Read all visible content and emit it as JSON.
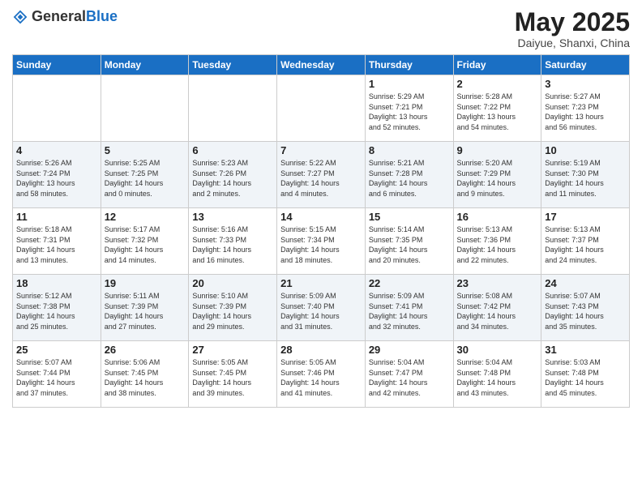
{
  "header": {
    "logo_general": "General",
    "logo_blue": "Blue",
    "month_year": "May 2025",
    "location": "Daiyue, Shanxi, China"
  },
  "weekdays": [
    "Sunday",
    "Monday",
    "Tuesday",
    "Wednesday",
    "Thursday",
    "Friday",
    "Saturday"
  ],
  "weeks": [
    [
      {
        "day": "",
        "info": ""
      },
      {
        "day": "",
        "info": ""
      },
      {
        "day": "",
        "info": ""
      },
      {
        "day": "",
        "info": ""
      },
      {
        "day": "1",
        "info": "Sunrise: 5:29 AM\nSunset: 7:21 PM\nDaylight: 13 hours\nand 52 minutes."
      },
      {
        "day": "2",
        "info": "Sunrise: 5:28 AM\nSunset: 7:22 PM\nDaylight: 13 hours\nand 54 minutes."
      },
      {
        "day": "3",
        "info": "Sunrise: 5:27 AM\nSunset: 7:23 PM\nDaylight: 13 hours\nand 56 minutes."
      }
    ],
    [
      {
        "day": "4",
        "info": "Sunrise: 5:26 AM\nSunset: 7:24 PM\nDaylight: 13 hours\nand 58 minutes."
      },
      {
        "day": "5",
        "info": "Sunrise: 5:25 AM\nSunset: 7:25 PM\nDaylight: 14 hours\nand 0 minutes."
      },
      {
        "day": "6",
        "info": "Sunrise: 5:23 AM\nSunset: 7:26 PM\nDaylight: 14 hours\nand 2 minutes."
      },
      {
        "day": "7",
        "info": "Sunrise: 5:22 AM\nSunset: 7:27 PM\nDaylight: 14 hours\nand 4 minutes."
      },
      {
        "day": "8",
        "info": "Sunrise: 5:21 AM\nSunset: 7:28 PM\nDaylight: 14 hours\nand 6 minutes."
      },
      {
        "day": "9",
        "info": "Sunrise: 5:20 AM\nSunset: 7:29 PM\nDaylight: 14 hours\nand 9 minutes."
      },
      {
        "day": "10",
        "info": "Sunrise: 5:19 AM\nSunset: 7:30 PM\nDaylight: 14 hours\nand 11 minutes."
      }
    ],
    [
      {
        "day": "11",
        "info": "Sunrise: 5:18 AM\nSunset: 7:31 PM\nDaylight: 14 hours\nand 13 minutes."
      },
      {
        "day": "12",
        "info": "Sunrise: 5:17 AM\nSunset: 7:32 PM\nDaylight: 14 hours\nand 14 minutes."
      },
      {
        "day": "13",
        "info": "Sunrise: 5:16 AM\nSunset: 7:33 PM\nDaylight: 14 hours\nand 16 minutes."
      },
      {
        "day": "14",
        "info": "Sunrise: 5:15 AM\nSunset: 7:34 PM\nDaylight: 14 hours\nand 18 minutes."
      },
      {
        "day": "15",
        "info": "Sunrise: 5:14 AM\nSunset: 7:35 PM\nDaylight: 14 hours\nand 20 minutes."
      },
      {
        "day": "16",
        "info": "Sunrise: 5:13 AM\nSunset: 7:36 PM\nDaylight: 14 hours\nand 22 minutes."
      },
      {
        "day": "17",
        "info": "Sunrise: 5:13 AM\nSunset: 7:37 PM\nDaylight: 14 hours\nand 24 minutes."
      }
    ],
    [
      {
        "day": "18",
        "info": "Sunrise: 5:12 AM\nSunset: 7:38 PM\nDaylight: 14 hours\nand 25 minutes."
      },
      {
        "day": "19",
        "info": "Sunrise: 5:11 AM\nSunset: 7:39 PM\nDaylight: 14 hours\nand 27 minutes."
      },
      {
        "day": "20",
        "info": "Sunrise: 5:10 AM\nSunset: 7:39 PM\nDaylight: 14 hours\nand 29 minutes."
      },
      {
        "day": "21",
        "info": "Sunrise: 5:09 AM\nSunset: 7:40 PM\nDaylight: 14 hours\nand 31 minutes."
      },
      {
        "day": "22",
        "info": "Sunrise: 5:09 AM\nSunset: 7:41 PM\nDaylight: 14 hours\nand 32 minutes."
      },
      {
        "day": "23",
        "info": "Sunrise: 5:08 AM\nSunset: 7:42 PM\nDaylight: 14 hours\nand 34 minutes."
      },
      {
        "day": "24",
        "info": "Sunrise: 5:07 AM\nSunset: 7:43 PM\nDaylight: 14 hours\nand 35 minutes."
      }
    ],
    [
      {
        "day": "25",
        "info": "Sunrise: 5:07 AM\nSunset: 7:44 PM\nDaylight: 14 hours\nand 37 minutes."
      },
      {
        "day": "26",
        "info": "Sunrise: 5:06 AM\nSunset: 7:45 PM\nDaylight: 14 hours\nand 38 minutes."
      },
      {
        "day": "27",
        "info": "Sunrise: 5:05 AM\nSunset: 7:45 PM\nDaylight: 14 hours\nand 39 minutes."
      },
      {
        "day": "28",
        "info": "Sunrise: 5:05 AM\nSunset: 7:46 PM\nDaylight: 14 hours\nand 41 minutes."
      },
      {
        "day": "29",
        "info": "Sunrise: 5:04 AM\nSunset: 7:47 PM\nDaylight: 14 hours\nand 42 minutes."
      },
      {
        "day": "30",
        "info": "Sunrise: 5:04 AM\nSunset: 7:48 PM\nDaylight: 14 hours\nand 43 minutes."
      },
      {
        "day": "31",
        "info": "Sunrise: 5:03 AM\nSunset: 7:48 PM\nDaylight: 14 hours\nand 45 minutes."
      }
    ]
  ]
}
